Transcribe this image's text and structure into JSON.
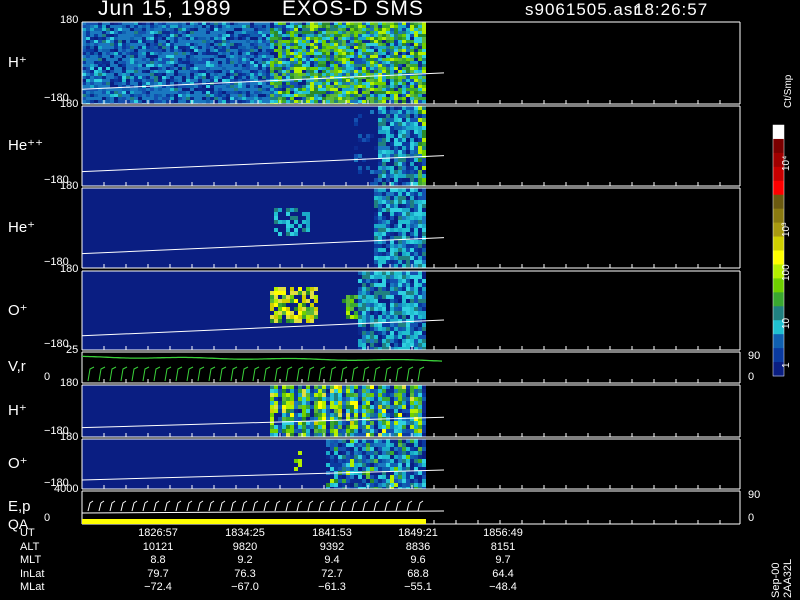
{
  "header": {
    "date": "Jun 15, 1989",
    "instrument": "EXOS-D SMS",
    "file": "s9061505.asr",
    "time": "18:26:57"
  },
  "chart_data": {
    "type": "heatmap",
    "time_axis": [
      "1826:57",
      "1834:25",
      "1841:53",
      "1849:21",
      "1856:49"
    ],
    "panels": [
      {
        "id": "h-plus",
        "label": "H⁺",
        "ytop": "180",
        "ybot": "−180"
      },
      {
        "id": "he-plus-plus",
        "label": "He⁺⁺",
        "ytop": "180",
        "ybot": "−180"
      },
      {
        "id": "he-plus",
        "label": "He⁺",
        "ytop": "180",
        "ybot": "−180"
      },
      {
        "id": "o-plus",
        "label": "O⁺",
        "ytop": "180",
        "ybot": "−180"
      },
      {
        "id": "v-r",
        "label": "V,r",
        "ytop": "25",
        "ybot": "0",
        "right_top": "90",
        "right_bot": "0"
      },
      {
        "id": "h-plus-2",
        "label": "H⁺",
        "ytop": "180",
        "ybot": "−180"
      },
      {
        "id": "o-plus-2",
        "label": "O⁺",
        "ytop": "180",
        "ybot": "−180"
      },
      {
        "id": "e-p-qa",
        "label": "E,p",
        "label2": "QA",
        "ytop": "4000",
        "ybot": "0",
        "right_top": "90",
        "right_bot": "0"
      }
    ],
    "colorbar": {
      "label": "Ct/Smp",
      "ticks": [
        "10⁴",
        "10³",
        "100",
        "10",
        "1"
      ],
      "colors": [
        "#ffffff",
        "#7a0000",
        "#a00000",
        "#c80000",
        "#ff0000",
        "#6b5a10",
        "#8a7a10",
        "#a89a10",
        "#cfcf00",
        "#ffff00",
        "#b4f000",
        "#6fd000",
        "#3aa830",
        "#208080",
        "#20c0d0",
        "#1060b0",
        "#0a3aa0",
        "#0a1e82"
      ]
    },
    "footer": {
      "rows": [
        {
          "label": "UT",
          "values": [
            "1826:57",
            "1834:25",
            "1841:53",
            "1849:21",
            "1856:49"
          ]
        },
        {
          "label": "ALT",
          "values": [
            "10121",
            "9820",
            "9392",
            "8836",
            "8151"
          ]
        },
        {
          "label": "MLT",
          "values": [
            "8.8",
            "9.2",
            "9.4",
            "9.6",
            "9.7"
          ]
        },
        {
          "label": "InLat",
          "values": [
            "79.7",
            "76.3",
            "72.7",
            "68.8",
            "64.4"
          ]
        },
        {
          "label": "MLat",
          "values": [
            "−72.4",
            "−67.0",
            "−61.3",
            "−55.1",
            "−48.4"
          ]
        }
      ]
    },
    "side_note": "Sep-00  2AA32L"
  }
}
